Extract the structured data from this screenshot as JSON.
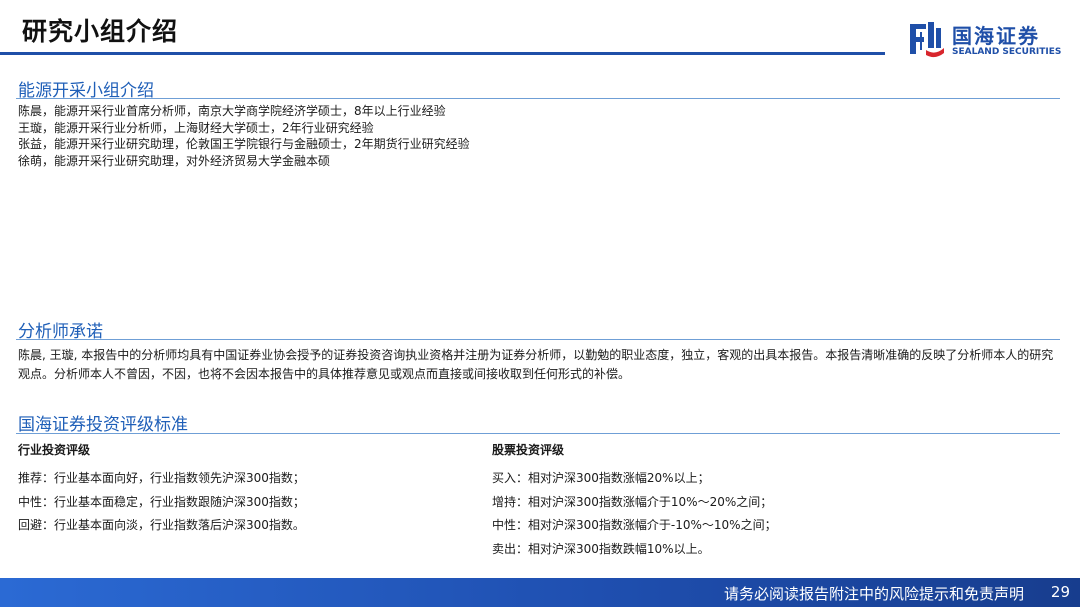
{
  "header": {
    "title": "研究小组介绍",
    "logo_cn": "国海证券",
    "logo_en": "SEALAND SECURITIES",
    "brand_color": "#1f4fa8"
  },
  "team": {
    "heading": "能源开采小组介绍",
    "members": [
      "陈晨，能源开采行业首席分析师，南京大学商学院经济学硕士，8年以上行业经验",
      "王璇，能源开采行业分析师，上海财经大学硕士，2年行业研究经验",
      "张益，能源开采行业研究助理，伦敦国王学院银行与金融硕士，2年期货行业研究经验",
      "徐萌，能源开采行业研究助理，对外经济贸易大学金融本硕"
    ]
  },
  "commitment": {
    "heading": "分析师承诺",
    "text": "陈晨, 王璇, 本报告中的分析师均具有中国证券业协会授予的证券投资咨询执业资格并注册为证券分析师，以勤勉的职业态度，独立，客观的出具本报告。本报告清晰准确的反映了分析师本人的研究观点。分析师本人不曾因，不因，也将不会因本报告中的具体推荐意见或观点而直接或间接收取到任何形式的补偿。"
  },
  "ratings": {
    "heading": "国海证券投资评级标准",
    "industry": {
      "title": "行业投资评级",
      "items": [
        "推荐：行业基本面向好，行业指数领先沪深300指数；",
        "中性：行业基本面稳定，行业指数跟随沪深300指数；",
        "回避：行业基本面向淡，行业指数落后沪深300指数。"
      ]
    },
    "stock": {
      "title": "股票投资评级",
      "items": [
        "买入：相对沪深300指数涨幅20%以上；",
        "增持：相对沪深300指数涨幅介于10%～20%之间；",
        "中性：相对沪深300指数涨幅介于-10%～10%之间；",
        "卖出：相对沪深300指数跌幅10%以上。"
      ]
    }
  },
  "footer": {
    "disclaimer": "请务必阅读报告附注中的风险提示和免责声明",
    "page_number": "29"
  }
}
